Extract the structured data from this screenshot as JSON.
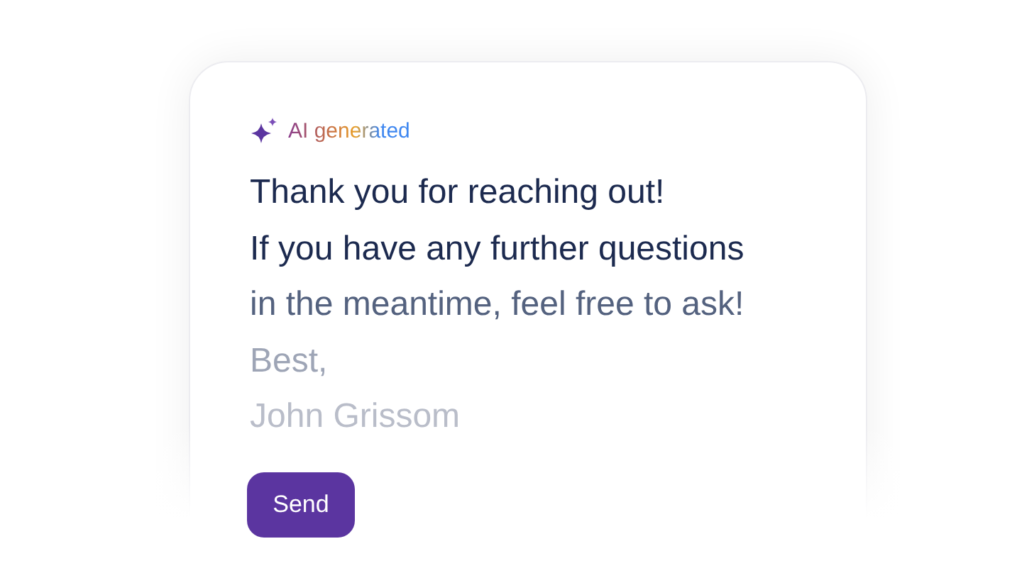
{
  "badge": {
    "label": "AI generated"
  },
  "message_lines": [
    "Thank you for reaching out!",
    "If you have any further questions",
    "in the meantime, feel free to ask!",
    "Best,",
    "John Grissom"
  ],
  "button": {
    "label": "Send"
  }
}
